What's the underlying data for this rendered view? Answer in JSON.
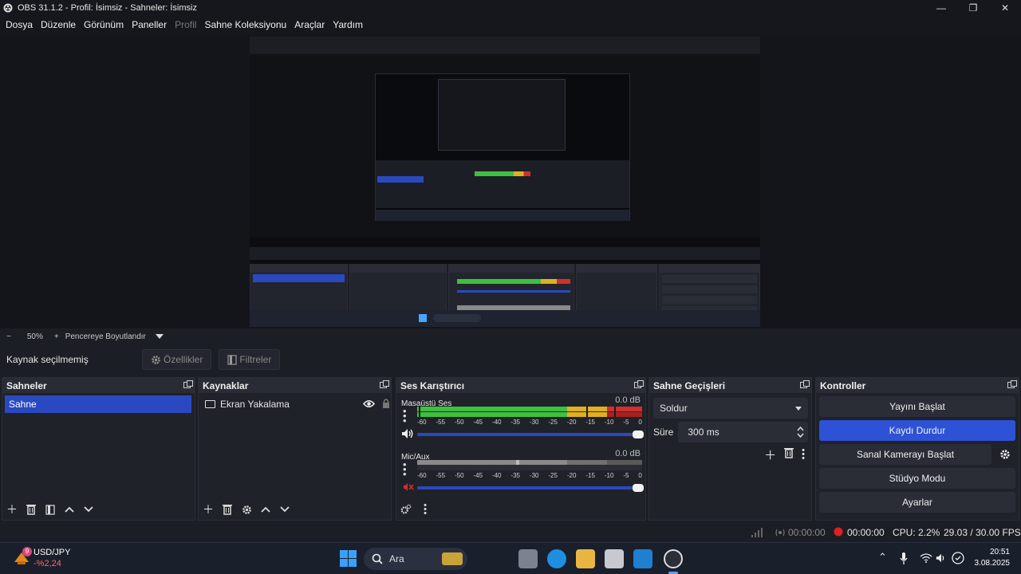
{
  "window": {
    "title": "OBS 31.1.2 - Profil: İsimsiz - Sahneler: İsimsiz"
  },
  "menu": [
    "Dosya",
    "Düzenle",
    "Görünüm",
    "Paneller",
    "Profil",
    "Sahne Koleksiyonu",
    "Araçlar",
    "Yardım"
  ],
  "zoom": {
    "minus": "−",
    "value": "50%",
    "plus": "+",
    "fit_label": "Pencereye Boyutlandır"
  },
  "source_bar": {
    "no_selection": "Kaynak seçilmemiş",
    "properties": "Özellikler",
    "filters": "Filtreler"
  },
  "docks": {
    "scenes": {
      "title": "Sahneler",
      "items": [
        "Sahne"
      ]
    },
    "sources": {
      "title": "Kaynaklar",
      "items": [
        "Ekran Yakalama"
      ]
    },
    "mixer": {
      "title": "Ses Karıştırıcı",
      "channels": [
        {
          "name": "Masaüstü Ses",
          "db": "0.0 dB",
          "level": 1.0,
          "muted": false
        },
        {
          "name": "Mic/Aux",
          "db": "0.0 dB",
          "level": 0.0,
          "muted": true
        }
      ],
      "scale": [
        "-60",
        "-55",
        "-50",
        "-45",
        "-40",
        "-35",
        "-30",
        "-25",
        "-20",
        "-15",
        "-10",
        "-5",
        "0"
      ]
    },
    "transitions": {
      "title": "Sahne Geçişleri",
      "selected": "Soldur",
      "duration_label": "Süre",
      "duration_value": "300 ms"
    },
    "controls": {
      "title": "Kontroller",
      "buttons": {
        "stream": "Yayını Başlat",
        "record": "Kaydı Durdur",
        "virtualcam": "Sanal Kamerayı Başlat",
        "studio": "Stüdyo Modu",
        "settings": "Ayarlar"
      }
    }
  },
  "status": {
    "stream_time": "00:00:00",
    "rec_time": "00:00:00",
    "cpu": "CPU: 2.2%",
    "fps": "29.03 / 30.00 FPS"
  },
  "taskbar": {
    "widget": {
      "title": "USD/JPY",
      "change": "-%2,24",
      "badge": "9"
    },
    "search": "Ara",
    "clock": {
      "time": "20:51",
      "date": "3.08.2025"
    }
  },
  "colors": {
    "accent": "#2d52d6",
    "meter_green": "#3fbf3f",
    "meter_yellow": "#e0b020",
    "meter_red": "#d03030",
    "rec_red": "#e02020"
  }
}
